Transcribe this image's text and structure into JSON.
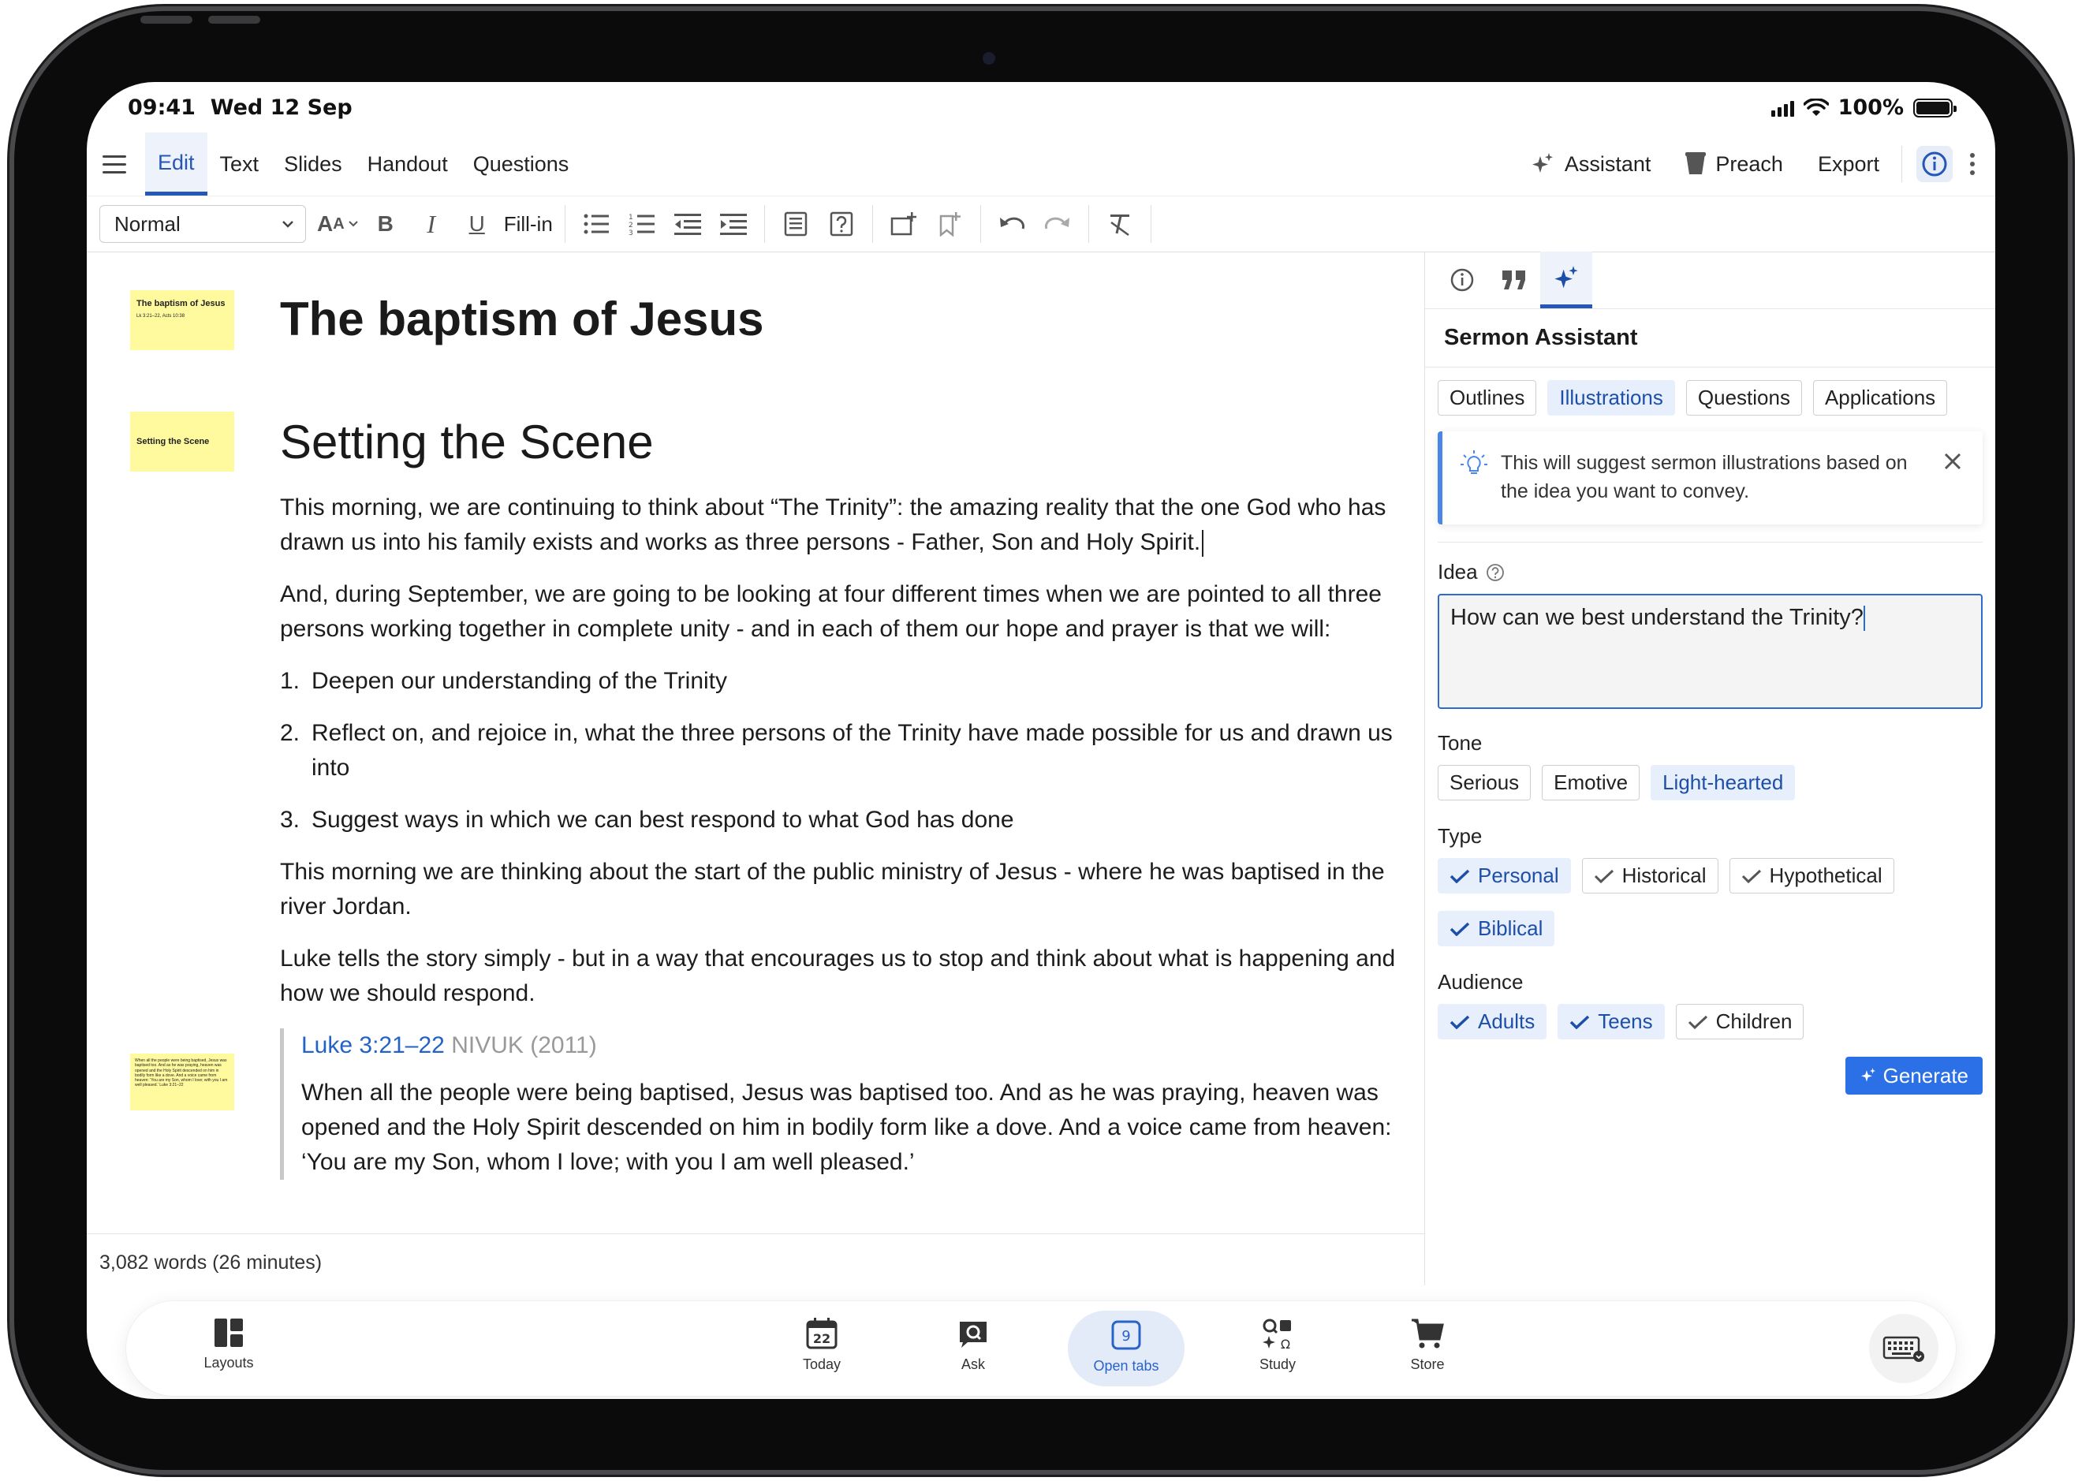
{
  "status": {
    "time": "09:41",
    "date": "Wed 12 Sep",
    "battery": "100%",
    "battery_level": 1.0
  },
  "menu": {
    "tabs": [
      "Edit",
      "Text",
      "Slides",
      "Handout",
      "Questions"
    ],
    "active_tab": "Edit",
    "assistant": "Assistant",
    "preach": "Preach",
    "export": "Export"
  },
  "toolbar": {
    "style": "Normal",
    "fill_in": "Fill-in"
  },
  "document": {
    "title": "The baptism of Jesus",
    "heading": "Setting the Scene",
    "paragraphs": [
      "This morning, we are continuing to think about “The Trinity”: the amazing reality that the one God who has drawn us into his family exists and works as three persons - Father, Son and Holy Spirit.",
      "And, during September, we are going to be looking at four different times when we are pointed to all three persons working together in complete unity - and in each of them our hope and prayer is that we will:"
    ],
    "list": [
      {
        "num": "1.",
        "text": "Deepen our understanding of the Trinity"
      },
      {
        "num": "2.",
        "text": "Reflect on, and rejoice in, what the three persons of the Trinity have made possible for us and drawn us into"
      },
      {
        "num": "3.",
        "text": "Suggest ways in which we can best respond to what God has done"
      }
    ],
    "paragraphs2": [
      "This morning we are thinking about the start of the public ministry of Jesus - where he was  baptised in the river Jordan.",
      "Luke tells the story simply - but in a way that encourages us to stop and think about what is happening and how we should respond."
    ],
    "scripture": {
      "reference": "Luke 3:21–22",
      "version": "NIVUK (2011)",
      "text": "When all the people were being baptised, Jesus was baptised too. And as he was praying, heaven was opened and the Holy Spirit descended on him in bodily form like a dove. And a voice came from heaven: ‘You are my Son, whom I love; with you I am well pleased.’"
    },
    "slides": [
      {
        "title": "The baptism of Jesus",
        "sub": "Lk 3:21–22, Acts 10:38"
      },
      {
        "title": "Setting the Scene",
        "sub": ""
      },
      {
        "title": "",
        "sub": "When all the people were being baptised, Jesus was baptised too. And as he was praying, heaven was opened and the Holy Spirit descended on him in bodily form like a dove. And a voice came from heaven: ‘You are my Son, whom I love; with you I am well pleased.’ Luke 3:21–22"
      }
    ]
  },
  "word_count": "3,082 words (26 minutes)",
  "panel": {
    "title": "Sermon Assistant",
    "mode_chips": [
      {
        "label": "Outlines",
        "selected": false
      },
      {
        "label": "Illustrations",
        "selected": true
      },
      {
        "label": "Questions",
        "selected": false
      },
      {
        "label": "Applications",
        "selected": false
      }
    ],
    "notice": "This will suggest sermon illustrations based on the idea you want to convey.",
    "idea_label": "Idea",
    "idea_value": "How can we best understand the Trinity?",
    "tone_label": "Tone",
    "tone": [
      {
        "label": "Serious",
        "selected": false
      },
      {
        "label": "Emotive",
        "selected": false
      },
      {
        "label": "Light-hearted",
        "selected": true
      }
    ],
    "type_label": "Type",
    "type": [
      {
        "label": "Personal",
        "selected": true
      },
      {
        "label": "Historical",
        "selected": true
      },
      {
        "label": "Hypothetical",
        "selected": true
      },
      {
        "label": "Biblical",
        "selected": true
      }
    ],
    "audience_label": "Audience",
    "audience": [
      {
        "label": "Adults",
        "selected": true
      },
      {
        "label": "Teens",
        "selected": true
      },
      {
        "label": "Children",
        "selected": true
      }
    ],
    "generate": "Generate"
  },
  "dock": {
    "items": [
      "Layouts",
      "Today",
      "Ask",
      "Open tabs",
      "Study",
      "Store"
    ],
    "today_day": "22",
    "open_tabs_count": "9"
  },
  "colors": {
    "accent": "#2457b8",
    "slide_yellow": "#fffa9e",
    "generate_blue": "#2c70e8"
  }
}
